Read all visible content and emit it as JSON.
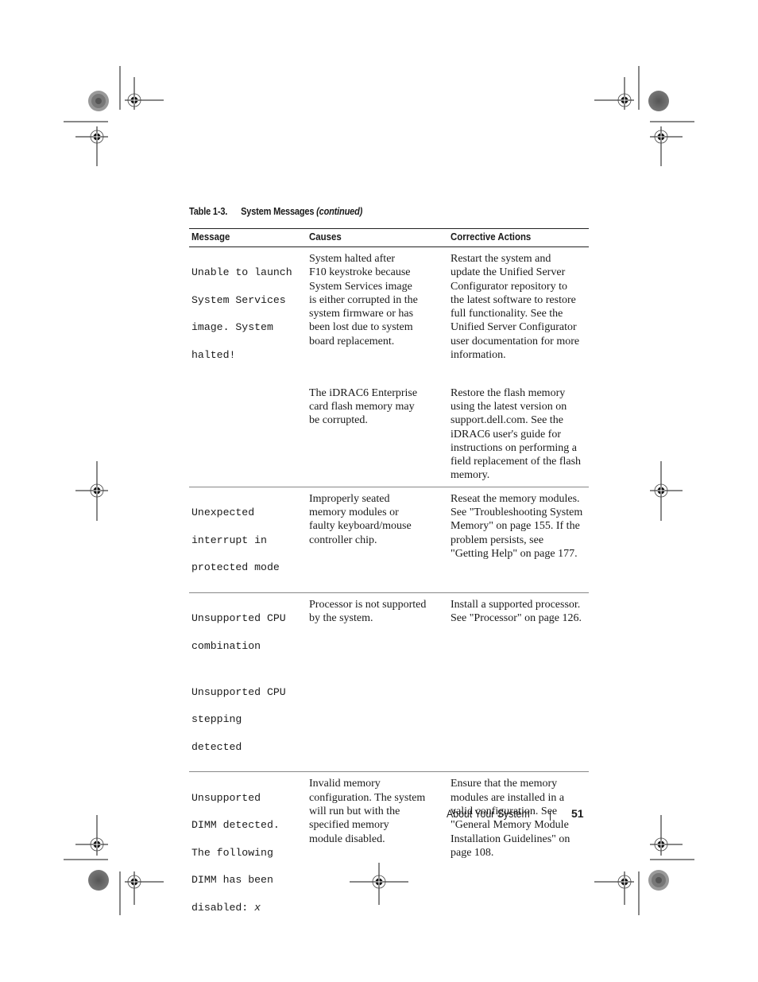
{
  "table": {
    "caption_number": "Table 1-3.",
    "caption_title": "System Messages",
    "caption_continued": "(continued)",
    "headers": [
      "Message",
      "Causes",
      "Corrective Actions"
    ],
    "rows": [
      {
        "message_lines": [
          "Unable to launch",
          "System Services",
          "image. System",
          "halted!"
        ],
        "causes_lines": [
          "System halted after",
          "F10 keystroke because",
          "System Services image",
          "is either corrupted in the",
          "system firmware or has",
          "been lost due to system",
          "board replacement."
        ],
        "actions_lines": [
          "Restart the system and",
          "update the Unified Server",
          "Configurator repository to",
          "the latest software to restore",
          "full functionality. See the",
          "Unified Server Configurator",
          "user documentation for more",
          "information."
        ]
      },
      {
        "message_lines": [],
        "causes_lines": [
          "The iDRAC6 Enterprise",
          "card flash memory may",
          "be corrupted."
        ],
        "actions_lines": [
          "Restore the flash memory",
          "using the latest version on",
          "support.dell.com. See the",
          "iDRAC6 user's guide for",
          "instructions on performing a",
          "field replacement of the flash",
          "memory."
        ]
      },
      {
        "message_lines": [
          "Unexpected",
          "interrupt in",
          "protected mode"
        ],
        "causes_lines": [
          "Improperly seated",
          "memory modules or",
          "faulty keyboard/mouse",
          "controller chip."
        ],
        "actions_lines": [
          "Reseat the memory modules.",
          "See \"Troubleshooting System",
          "Memory\" on page 155. If the",
          "problem persists, see",
          "\"Getting Help\" on page 177."
        ]
      },
      {
        "message_lines": [
          "Unsupported CPU",
          "combination"
        ],
        "message2_lines": [
          "Unsupported CPU",
          "stepping",
          "detected"
        ],
        "causes_lines": [
          "Processor is not supported",
          "by the system."
        ],
        "actions_lines": [
          "Install a supported processor.",
          "See \"Processor\" on page 126."
        ]
      },
      {
        "message_lines": [
          "Unsupported",
          "DIMM detected.",
          "The following",
          "DIMM has been",
          "disabled: "
        ],
        "message_variable": "x",
        "causes_lines": [
          "Invalid memory",
          "configuration. The system",
          "will run but with the",
          "specified memory",
          "module disabled."
        ],
        "actions_lines": [
          "Ensure that the memory",
          "modules are installed in a",
          "valid configuration. See",
          "\"General Memory Module",
          "Installation Guidelines\" on",
          "page 108."
        ]
      }
    ]
  },
  "footer": {
    "section": "About Your System",
    "page_number": "51"
  },
  "print_marks": {
    "registration_mark_icon": "crosshair-circle",
    "color_bar_icons": [
      "starburst-circle",
      "gray-noise-circle"
    ]
  }
}
